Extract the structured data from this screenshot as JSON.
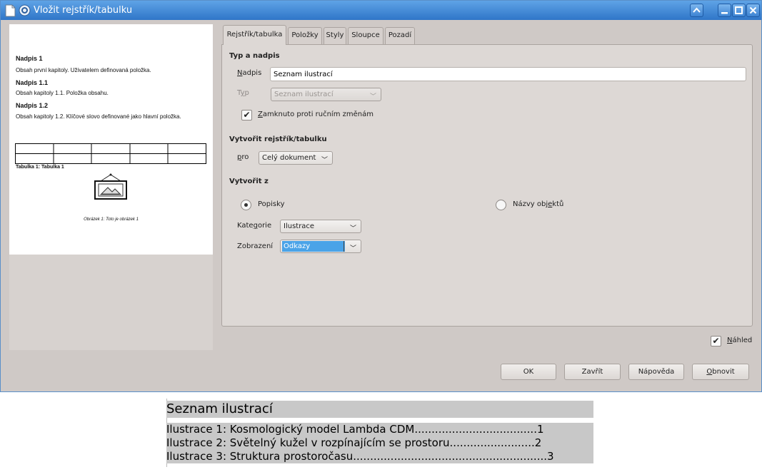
{
  "window": {
    "title": "Vložit rejstřík/tabulku"
  },
  "preview": {
    "heading1": "Nadpis 1",
    "text1": "Obsah první kapitoly. Uživatelem definovaná položka.",
    "heading11": "Nadpis 1.1",
    "text11": "Obsah kapitoly 1.1. Položka obsahu.",
    "heading12": "Nadpis 1.2",
    "text12": "Obsah kapitoly 1.2. Klíčové slovo definované jako hlavní položka.",
    "table_caption": "Tabulka 1: Tabulka 1",
    "image_caption": "Obrázek 1: Toto je obrázek 1"
  },
  "tabs": [
    {
      "label": "Rejstřík/tabulka",
      "active": true
    },
    {
      "label": "Položky"
    },
    {
      "label": "Styly"
    },
    {
      "label": "Sloupce"
    },
    {
      "label": "Pozadí"
    }
  ],
  "type_section": {
    "title": "Typ a nadpis",
    "title_label": "Nadpis",
    "title_value": "Seznam ilustrací",
    "type_label": "Typ",
    "type_value": "Seznam ilustrací",
    "protect_label": "Zamknuto proti ručním změnám",
    "protect_checked": true
  },
  "create_section": {
    "title": "Vytvořit rejstřík/tabulku",
    "for_label": "pro",
    "for_value": "Celý dokument"
  },
  "from_section": {
    "title": "Vytvořit z",
    "captions_label": "Popisky",
    "captions_selected": true,
    "object_names_label": "Názvy objektů",
    "category_label": "Kategorie",
    "category_value": "Ilustrace",
    "display_label": "Zobrazení",
    "display_value": "Odkazy"
  },
  "preview_check": {
    "label": "Náhled",
    "checked": true
  },
  "buttons": {
    "ok": "OK",
    "close": "Zavřít",
    "help": "Nápověda",
    "reset": "Obnovit"
  },
  "document": {
    "heading": "Seznam ilustrací",
    "entries": [
      "Ilustrace 1: Kosmologický model Lambda CDM....................................1",
      "Ilustrace 2: Světelný kužel v rozpínajícím se prostoru.........................2",
      "Ilustrace 3: Struktura prostoročasu.........................................................3"
    ]
  },
  "colors": {
    "titlebar": "#3a83d4",
    "dialog_bg": "#cfc9c6",
    "selection": "#4aa3e8"
  }
}
